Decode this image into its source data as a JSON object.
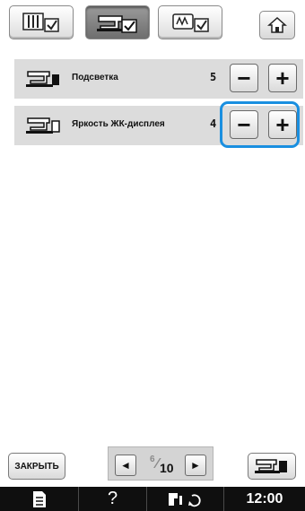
{
  "tabs": [
    {
      "name": "settings-page-general",
      "icon": "general-settings-icon",
      "active": false
    },
    {
      "name": "settings-page-sewing",
      "icon": "sewing-machine-settings-icon",
      "active": true
    },
    {
      "name": "settings-page-embroidery",
      "icon": "embroidery-settings-icon",
      "active": false
    }
  ],
  "home_icon": "home-icon",
  "settings": [
    {
      "label": "Подсветка",
      "value": "5",
      "minus": "−",
      "plus": "+"
    },
    {
      "label": "Яркость ЖК-дисплея",
      "value": "4",
      "minus": "−",
      "plus": "+"
    }
  ],
  "footer": {
    "close_label": "ЗАКРЫТЬ",
    "prev_glyph": "◄",
    "next_glyph": "►",
    "page_current": "6",
    "page_total": "10"
  },
  "statusbar": {
    "help": "?",
    "clock": "12:00"
  },
  "colors": {
    "focus": "#1a8fe0",
    "statusbar": "#0f0f0f",
    "row_bg": "#dcdcdc"
  }
}
